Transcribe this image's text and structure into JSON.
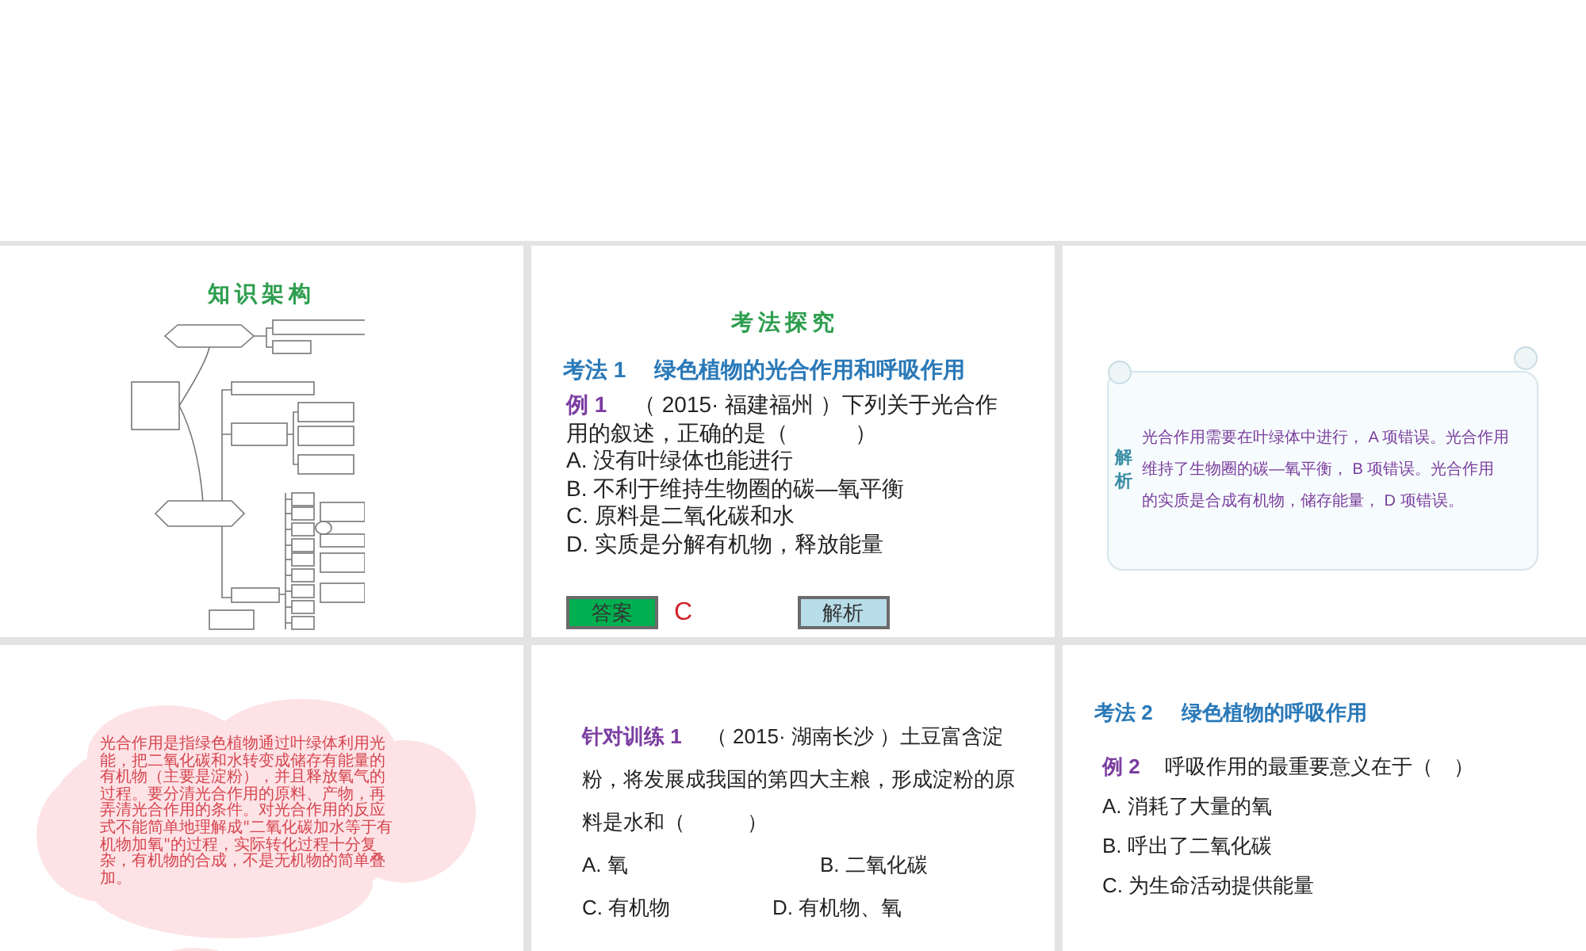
{
  "slides": [
    {
      "kind": "mindmap",
      "title": "知识架构"
    },
    {
      "kind": "example",
      "title": "考法探究",
      "heading": {
        "label": "考法 1",
        "text": "绿色植物的光合作用和呼吸作用"
      },
      "question": {
        "label": "例 1",
        "text": "（ 2015· 福建福州 ）下列关于光合作用的叙述，正确的是（　　　）"
      },
      "options": [
        "A. 没有叶绿体也能进行",
        "B. 不利于维持生物圈的碳—氧平衡",
        "C. 原料是二氧化碳和水",
        "D. 实质是分解有机物，释放能量"
      ],
      "buttons": [
        {
          "label": "答案",
          "kind": "answer"
        },
        {
          "label": "解析",
          "kind": "analysis"
        }
      ],
      "answer": "C"
    },
    {
      "kind": "analysis",
      "tag": "解析",
      "text": "光合作用需要在叶绿体中进行， A 项错误。光合作用维持了生物圈的碳—氧平衡， B 项错误。光合作用的实质是合成有机物，储存能量， D 项错误。"
    },
    {
      "kind": "note",
      "text": "光合作用是指绿色植物通过叶绿体利用光能，把二氧化碳和水转变成储存有能量的有机物（主要是淀粉），并且释放氧气的过程。要分清光合作用的原料、产物，再弄清光合作用的条件。对光合作用的反应式不能简单地理解成\"二氧化碳加水等于有机物加氧\"的过程，实际转化过程十分复杂，有机物的合成，不是无机物的简单叠加。"
    },
    {
      "kind": "exercise",
      "question": {
        "label": "针对训练 1",
        "text": "（ 2015· 湖南长沙 ）土豆富含淀粉，将发展成我国的第四大主粮，形成淀粉的原料是水和（　　　）"
      },
      "options": [
        "A. 氧",
        "B. 二氧化碳",
        "C. 有机物",
        "D. 有机物、氧"
      ]
    },
    {
      "kind": "example2",
      "heading": {
        "label": "考法 2",
        "text": "绿色植物的呼吸作用"
      },
      "question": {
        "label": "例 2",
        "text": "呼吸作用的最重要意义在于（　）"
      },
      "options": [
        "A. 消耗了大量的氧",
        "B. 呼出了二氧化碳",
        "C. 为生命活动提供能量"
      ]
    }
  ]
}
